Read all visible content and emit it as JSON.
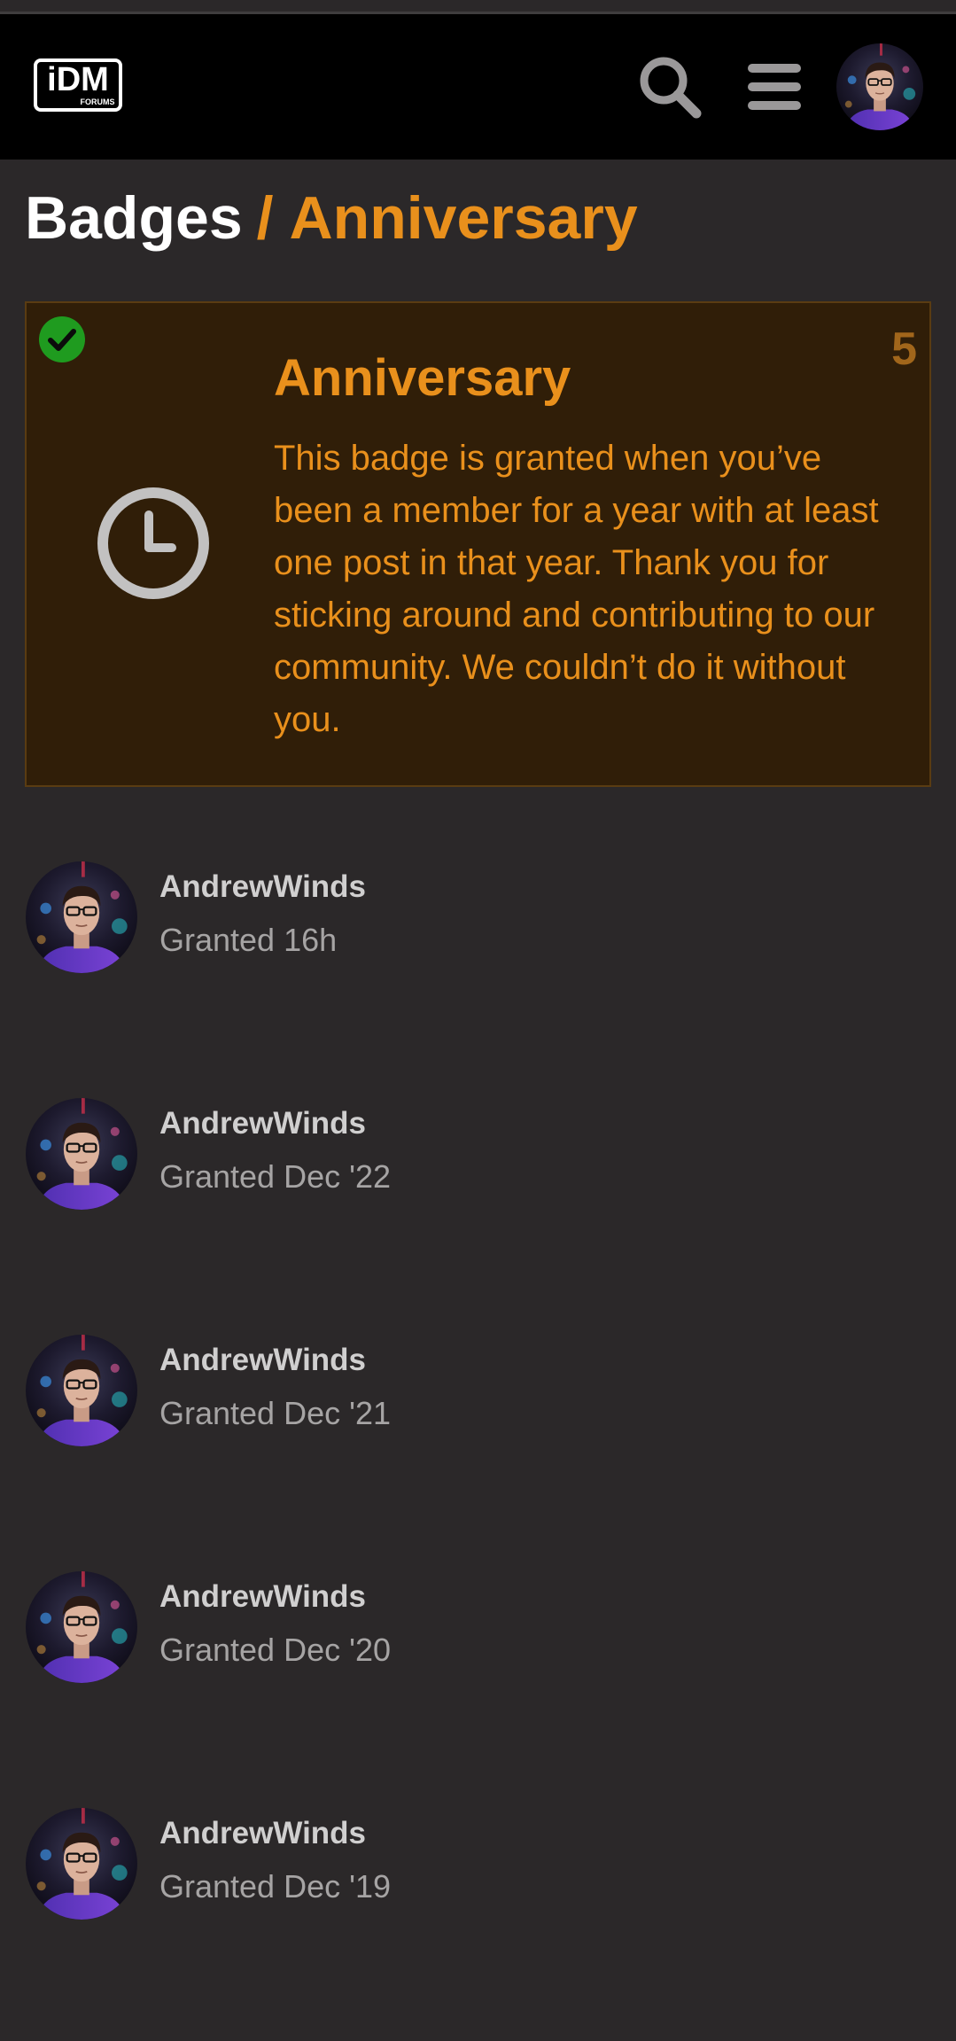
{
  "header": {
    "logo_text": "iDM",
    "logo_subtext": "FORUMS",
    "search_icon": "search-icon",
    "menu_icon": "hamburger-menu-icon",
    "user_avatar": "user-avatar"
  },
  "breadcrumb": {
    "parent": "Badges",
    "separator": "/",
    "current": "Anniversary"
  },
  "badge": {
    "name": "Anniversary",
    "grant_count": "5",
    "granted_icon": "check-circle-icon",
    "icon": "clock-icon",
    "description": "This badge is granted when you’ve been a member for a year with at least one post in that year. Thank you for sticking around and contributing to our community. We couldn’t do it without you."
  },
  "grants": [
    {
      "username": "AndrewWinds",
      "granted": "Granted 16h"
    },
    {
      "username": "AndrewWinds",
      "granted": "Granted Dec '22"
    },
    {
      "username": "AndrewWinds",
      "granted": "Granted Dec '21"
    },
    {
      "username": "AndrewWinds",
      "granted": "Granted Dec '20"
    },
    {
      "username": "AndrewWinds",
      "granted": "Granted Dec '19"
    }
  ],
  "colors": {
    "accent": "#e9901c",
    "background": "#2b2829",
    "header_bg": "#000000",
    "card_bg": "#301e08",
    "granted_green": "#1f9b1f"
  }
}
